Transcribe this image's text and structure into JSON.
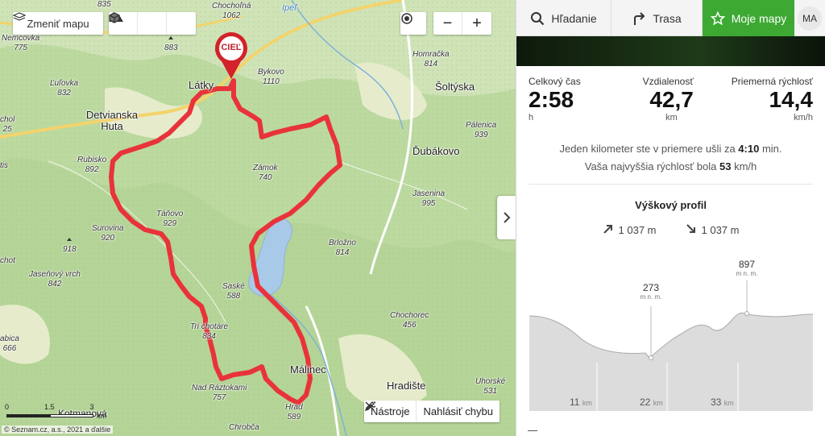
{
  "map": {
    "controls": {
      "change_map_label": "Zmeniť mapu",
      "zoom_in": "+",
      "zoom_out": "−"
    },
    "target_marker": "CIEĽ",
    "scale": {
      "ticks": [
        "0",
        "1.5",
        "3"
      ],
      "unit": "km"
    },
    "copyright": "© Seznam.cz, a.s., 2021 a ďalšie",
    "tools_label": "Nástroje",
    "report_label": "Nahlásiť chybu",
    "peaks": [
      {
        "name": "835",
        "alt": ""
      },
      {
        "name": "Chochoľná",
        "alt": "1062"
      },
      {
        "name": "883",
        "alt": ""
      },
      {
        "name": "Nemcovka",
        "alt": "775"
      },
      {
        "name": "Ľuľovka",
        "alt": "832"
      },
      {
        "name": "Bykovo",
        "alt": "1110"
      },
      {
        "name": "Homračka",
        "alt": "814"
      },
      {
        "name": "chol",
        "alt": "25"
      },
      {
        "name": "Pálenica",
        "alt": "939"
      },
      {
        "name": "Rubisko",
        "alt": "892"
      },
      {
        "name": "Zámok",
        "alt": "740"
      },
      {
        "name": "Jasenina",
        "alt": "995"
      },
      {
        "name": "Táňovo",
        "alt": "929"
      },
      {
        "name": "Surovina",
        "alt": "920"
      },
      {
        "name": "918",
        "alt": ""
      },
      {
        "name": "Brložno",
        "alt": "814"
      },
      {
        "name": "Jaseňový vrch",
        "alt": "842"
      },
      {
        "name": "Saské",
        "alt": "588"
      },
      {
        "name": "Chochorec",
        "alt": "456"
      },
      {
        "name": "Tri chotáre",
        "alt": "834"
      },
      {
        "name": "abica",
        "alt": "666"
      },
      {
        "name": "Uhorské",
        "alt": "531"
      },
      {
        "name": "Nad Ráztokami",
        "alt": "757"
      },
      {
        "name": "Hrad",
        "alt": "589"
      },
      {
        "name": "Chrobča",
        "alt": ""
      },
      {
        "name": "chot",
        "alt": ""
      },
      {
        "name": "tis",
        "alt": ""
      }
    ],
    "towns": [
      {
        "name": "Látky"
      },
      {
        "name": "Detvianska Huta"
      },
      {
        "name": "Šoltýska"
      },
      {
        "name": "Ďubákovo"
      },
      {
        "name": "Málinec"
      },
      {
        "name": "Hradište"
      },
      {
        "name": "Kotmanová"
      },
      {
        "name": "Ipeľ"
      }
    ]
  },
  "panel": {
    "nav": {
      "search": "Hľadanie",
      "route": "Trasa",
      "my_maps": "Moje mapy",
      "user_initials": "MA"
    },
    "stats": {
      "time": {
        "label": "Celkový čas",
        "value": "2:58",
        "unit": "h"
      },
      "distance": {
        "label": "Vzdialenosť",
        "value": "42,7",
        "unit": "km"
      },
      "speed": {
        "label": "Priemerná rýchlosť",
        "value": "14,4",
        "unit": "km/h"
      }
    },
    "summary": {
      "line1_pre": "Jeden kilometer ste v priemere ušli za",
      "line1_val": "4:10",
      "line1_post": "min.",
      "line2_pre": "Vaša najvyššia rýchlosť bola",
      "line2_val": "53",
      "line2_post": "km/h"
    },
    "elevation": {
      "title": "Výškový profil",
      "ascent": "1 037 m",
      "descent": "1 037 m",
      "min_label": "273",
      "max_label": "897",
      "alt_unit": "m n. m.",
      "x_ticks": [
        {
          "value": "11",
          "unit": "km"
        },
        {
          "value": "22",
          "unit": "km"
        },
        {
          "value": "33",
          "unit": "km"
        }
      ]
    }
  },
  "colors": {
    "route": "#e8333a",
    "accent_green": "#3da933",
    "water": "#a9c9e8",
    "forest": "#bcd9a0"
  }
}
